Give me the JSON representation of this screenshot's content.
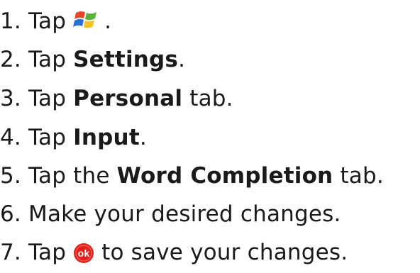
{
  "steps": [
    {
      "number": "1.",
      "prefix": "Tap",
      "icon": "windows-start-icon",
      "suffix": "."
    },
    {
      "number": "2.",
      "prefix": "Tap",
      "bold": "Settings",
      "suffix": "."
    },
    {
      "number": "3.",
      "prefix": "Tap",
      "bold": "Personal",
      "suffix": "tab."
    },
    {
      "number": "4.",
      "prefix": "Tap",
      "bold": "Input",
      "suffix": "."
    },
    {
      "number": "5.",
      "prefix": "Tap the",
      "bold": "Word Completion",
      "suffix": "tab."
    },
    {
      "number": "6.",
      "prefix": "Make your desired changes."
    },
    {
      "number": "7.",
      "prefix": "Tap",
      "icon": "ok-icon",
      "suffix": "to save your changes."
    }
  ],
  "icons": {
    "windows_logo_colors": [
      "#e8442a",
      "#5bb23a",
      "#2d6fd6",
      "#f5c21b"
    ],
    "ok_color": "#e3201b",
    "ok_label": "ok"
  }
}
